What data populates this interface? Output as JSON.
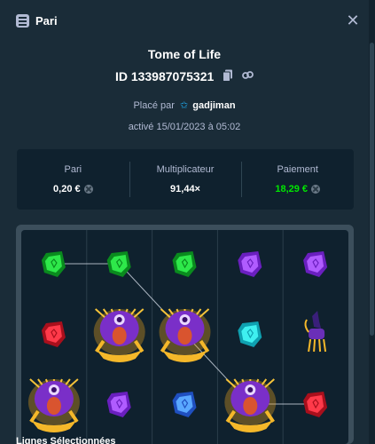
{
  "header": {
    "title": "Pari",
    "logo_icon": "casino-list-icon",
    "close_icon": "close-icon"
  },
  "bet": {
    "game_title": "Tome of Life",
    "id_label": "ID 133987075321",
    "placed_by_prefix": "Placé par",
    "username": "gadjiman",
    "activated": "activé 15/01/2023 à 05:02"
  },
  "stats": [
    {
      "label": "Pari",
      "value": "0,20 €",
      "coin": true,
      "color": "#ffffff"
    },
    {
      "label": "Multiplicateur",
      "value": "91,44×",
      "coin": false,
      "color": "#ffffff"
    },
    {
      "label": "Paiement",
      "value": "18,29 €",
      "coin": true,
      "color": "#00e701"
    }
  ],
  "board": {
    "columns": 5,
    "rows": 3,
    "symbols": [
      [
        "green-gem",
        "green-gem",
        "green-gem",
        "purple-gem",
        "purple-gem"
      ],
      [
        "red-gem",
        "pharaoh",
        "pharaoh",
        "cyan-gem",
        "anubis"
      ],
      [
        "pharaoh",
        "purple-gem",
        "blue-gem",
        "pharaoh",
        "red-gem"
      ]
    ],
    "win_line_color": "#cfd8e3"
  },
  "footer": {
    "label": "Lignes Sélectionnées"
  },
  "colors": {
    "background": "#1a2c38",
    "panel": "#0f212e",
    "muted": "#b1bad3",
    "win": "#00e701"
  }
}
